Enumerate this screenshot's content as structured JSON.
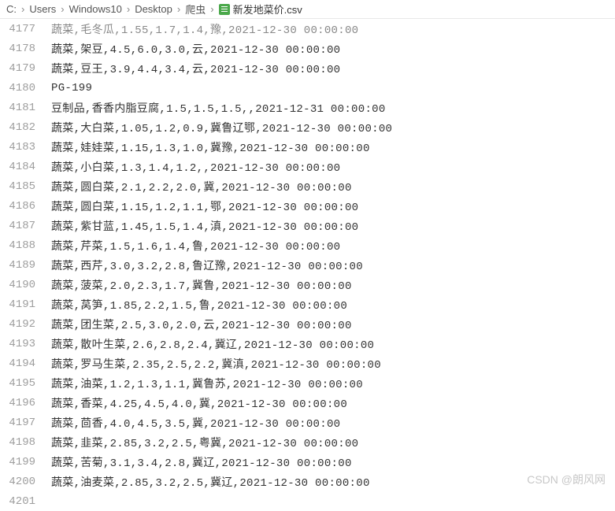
{
  "breadcrumb": {
    "parts": [
      "C:",
      "Users",
      "Windows10",
      "Desktop",
      "爬虫"
    ],
    "file": "新发地菜价.csv",
    "sep": "›"
  },
  "lines": [
    {
      "num": "4177",
      "text": "蔬菜,毛冬瓜,1.55,1.7,1.4,豫,2021-12-30 00:00:00",
      "faded": true
    },
    {
      "num": "4178",
      "text": "蔬菜,架豆,4.5,6.0,3.0,云,2021-12-30 00:00:00"
    },
    {
      "num": "4179",
      "text": "蔬菜,豆王,3.9,4.4,3.4,云,2021-12-30 00:00:00"
    },
    {
      "num": "4180",
      "text": "PG-199"
    },
    {
      "num": "4181",
      "text": "豆制品,香香内脂豆腐,1.5,1.5,1.5,,2021-12-31 00:00:00"
    },
    {
      "num": "4182",
      "text": "蔬菜,大白菜,1.05,1.2,0.9,冀鲁辽鄂,2021-12-30 00:00:00"
    },
    {
      "num": "4183",
      "text": "蔬菜,娃娃菜,1.15,1.3,1.0,冀豫,2021-12-30 00:00:00"
    },
    {
      "num": "4184",
      "text": "蔬菜,小白菜,1.3,1.4,1.2,,2021-12-30 00:00:00"
    },
    {
      "num": "4185",
      "text": "蔬菜,圆白菜,2.1,2.2,2.0,冀,2021-12-30 00:00:00"
    },
    {
      "num": "4186",
      "text": "蔬菜,圆白菜,1.15,1.2,1.1,鄂,2021-12-30 00:00:00"
    },
    {
      "num": "4187",
      "text": "蔬菜,紫甘蓝,1.45,1.5,1.4,滇,2021-12-30 00:00:00"
    },
    {
      "num": "4188",
      "text": "蔬菜,芹菜,1.5,1.6,1.4,鲁,2021-12-30 00:00:00"
    },
    {
      "num": "4189",
      "text": "蔬菜,西芹,3.0,3.2,2.8,鲁辽豫,2021-12-30 00:00:00"
    },
    {
      "num": "4190",
      "text": "蔬菜,菠菜,2.0,2.3,1.7,冀鲁,2021-12-30 00:00:00"
    },
    {
      "num": "4191",
      "text": "蔬菜,莴笋,1.85,2.2,1.5,鲁,2021-12-30 00:00:00"
    },
    {
      "num": "4192",
      "text": "蔬菜,团生菜,2.5,3.0,2.0,云,2021-12-30 00:00:00"
    },
    {
      "num": "4193",
      "text": "蔬菜,散叶生菜,2.6,2.8,2.4,冀辽,2021-12-30 00:00:00"
    },
    {
      "num": "4194",
      "text": "蔬菜,罗马生菜,2.35,2.5,2.2,冀滇,2021-12-30 00:00:00"
    },
    {
      "num": "4195",
      "text": "蔬菜,油菜,1.2,1.3,1.1,冀鲁苏,2021-12-30 00:00:00"
    },
    {
      "num": "4196",
      "text": "蔬菜,香菜,4.25,4.5,4.0,冀,2021-12-30 00:00:00"
    },
    {
      "num": "4197",
      "text": "蔬菜,茴香,4.0,4.5,3.5,冀,2021-12-30 00:00:00"
    },
    {
      "num": "4198",
      "text": "蔬菜,韭菜,2.85,3.2,2.5,粤冀,2021-12-30 00:00:00"
    },
    {
      "num": "4199",
      "text": "蔬菜,苦菊,3.1,3.4,2.8,冀辽,2021-12-30 00:00:00"
    },
    {
      "num": "4200",
      "text": "蔬菜,油麦菜,2.85,3.2,2.5,冀辽,2021-12-30 00:00:00"
    },
    {
      "num": "4201",
      "text": ""
    }
  ],
  "watermark": "CSDN @朗风网"
}
